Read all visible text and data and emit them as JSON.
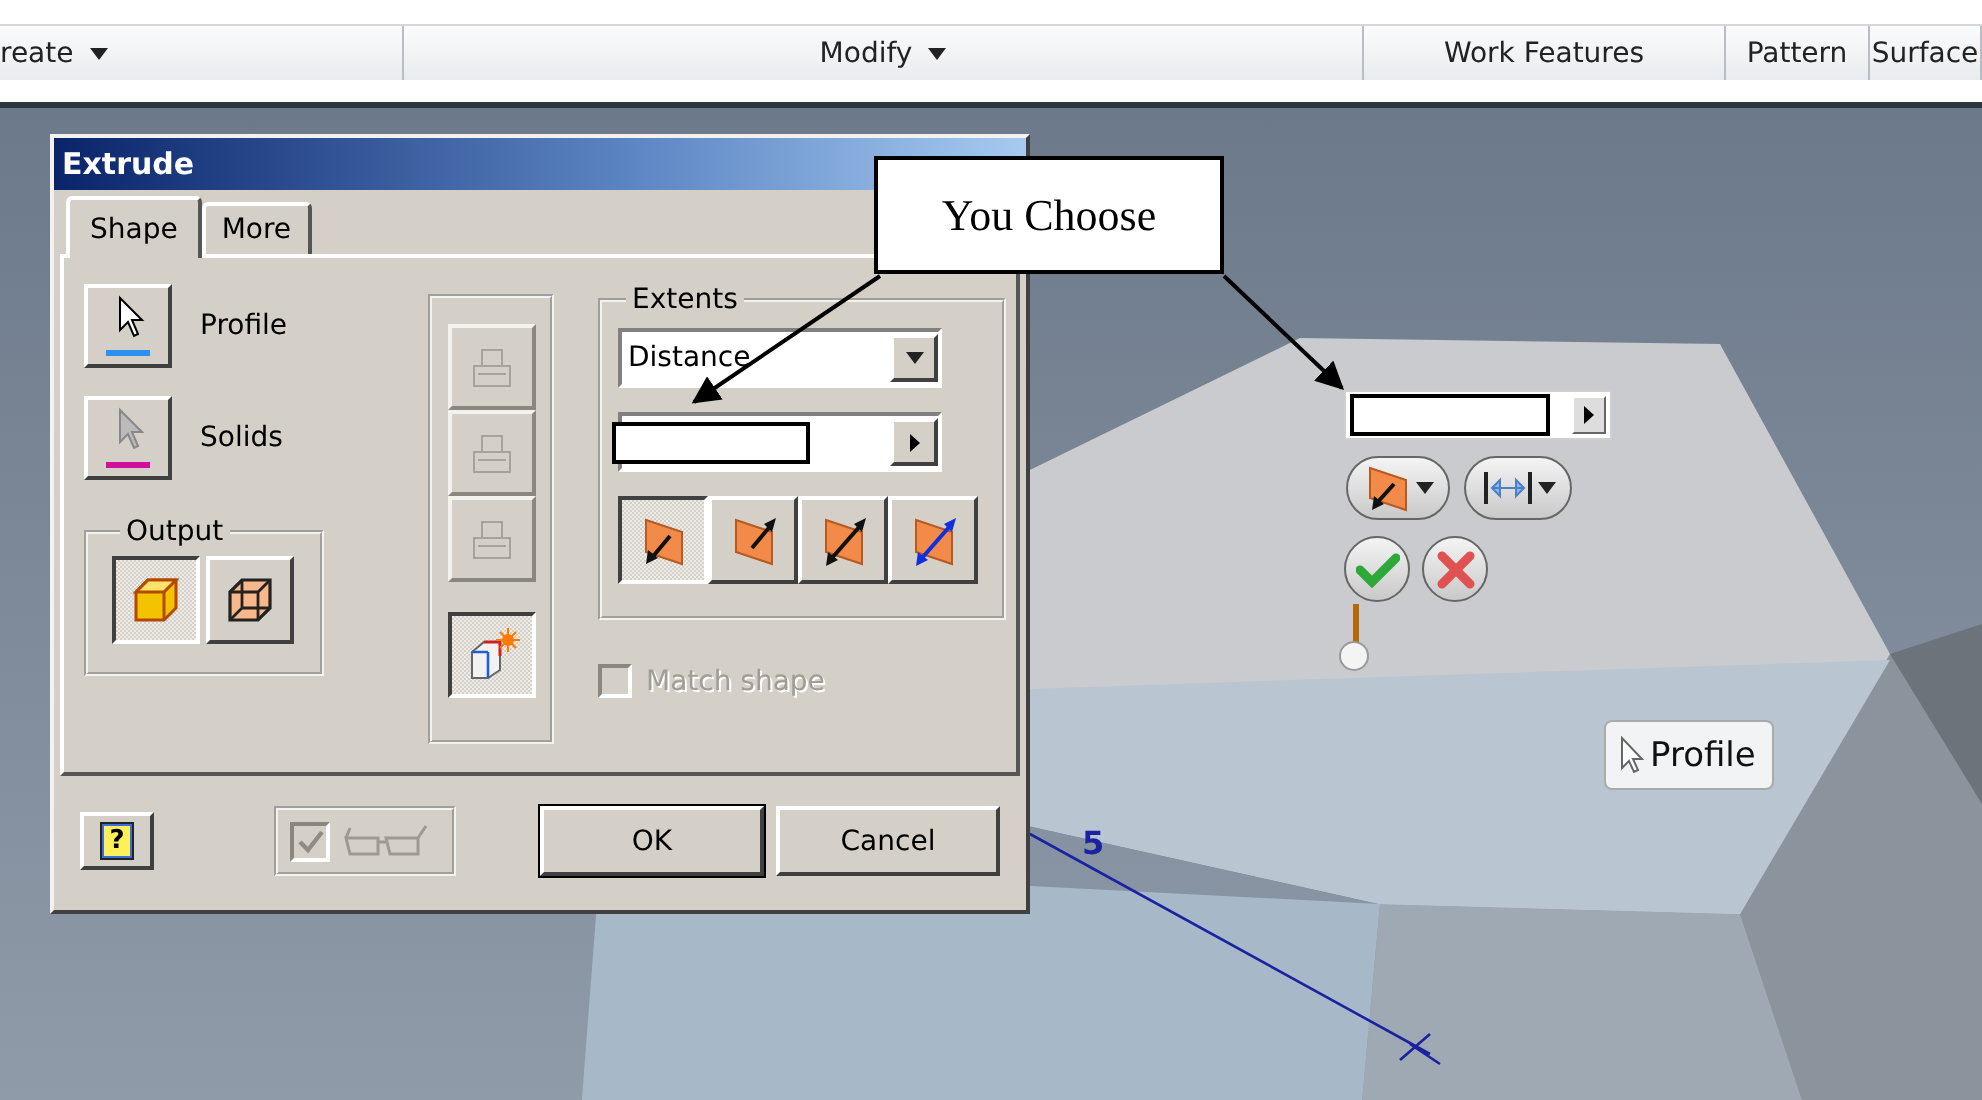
{
  "ribbon": {
    "panels": [
      {
        "label": "reate",
        "dropdown": true
      },
      {
        "label": "Modify",
        "dropdown": true
      },
      {
        "label": "Work Features",
        "dropdown": false
      },
      {
        "label": "Pattern",
        "dropdown": false
      },
      {
        "label": "Surface",
        "dropdown": false
      }
    ]
  },
  "dialog": {
    "title": "Extrude",
    "tabs": [
      {
        "label": "Shape",
        "selected": true
      },
      {
        "label": "More",
        "selected": false
      }
    ],
    "selectors": [
      {
        "label": "Profile",
        "kind": "profile"
      },
      {
        "label": "Solids",
        "kind": "solids"
      }
    ],
    "output": {
      "label": "Output",
      "options": [
        {
          "kind": "solid",
          "selected": true
        },
        {
          "kind": "surface",
          "selected": false
        }
      ]
    },
    "operations": [
      {
        "kind": "join",
        "disabled": true,
        "selected": false
      },
      {
        "kind": "cut",
        "disabled": true,
        "selected": false
      },
      {
        "kind": "intersect",
        "disabled": true,
        "selected": false
      },
      {
        "kind": "new-solid",
        "disabled": false,
        "selected": true
      }
    ],
    "extents": {
      "label": "Extents",
      "type": "Distance",
      "value_field": {
        "marked": true
      }
    },
    "directions": [
      {
        "kind": "default",
        "selected": true
      },
      {
        "kind": "flipped",
        "selected": false
      },
      {
        "kind": "symmetric",
        "selected": false
      },
      {
        "kind": "asymmetric",
        "selected": false
      }
    ],
    "match_shape": {
      "label": "Match shape",
      "checked": false,
      "disabled": true
    },
    "help_button": {
      "glyph": "?"
    },
    "preview": {
      "checked": true,
      "disabled": true
    },
    "buttons": [
      {
        "label": "OK",
        "default": true
      },
      {
        "label": "Cancel",
        "default": false
      }
    ]
  },
  "canvas": {
    "dimension": "5",
    "value_field": {
      "marked": true
    },
    "mini_toolbar": [
      {
        "kind": "direction"
      },
      {
        "kind": "measure"
      },
      {
        "kind": "apply"
      },
      {
        "kind": "cancel"
      }
    ],
    "tooltip": "Profile"
  },
  "callout": {
    "text": "You Choose"
  }
}
